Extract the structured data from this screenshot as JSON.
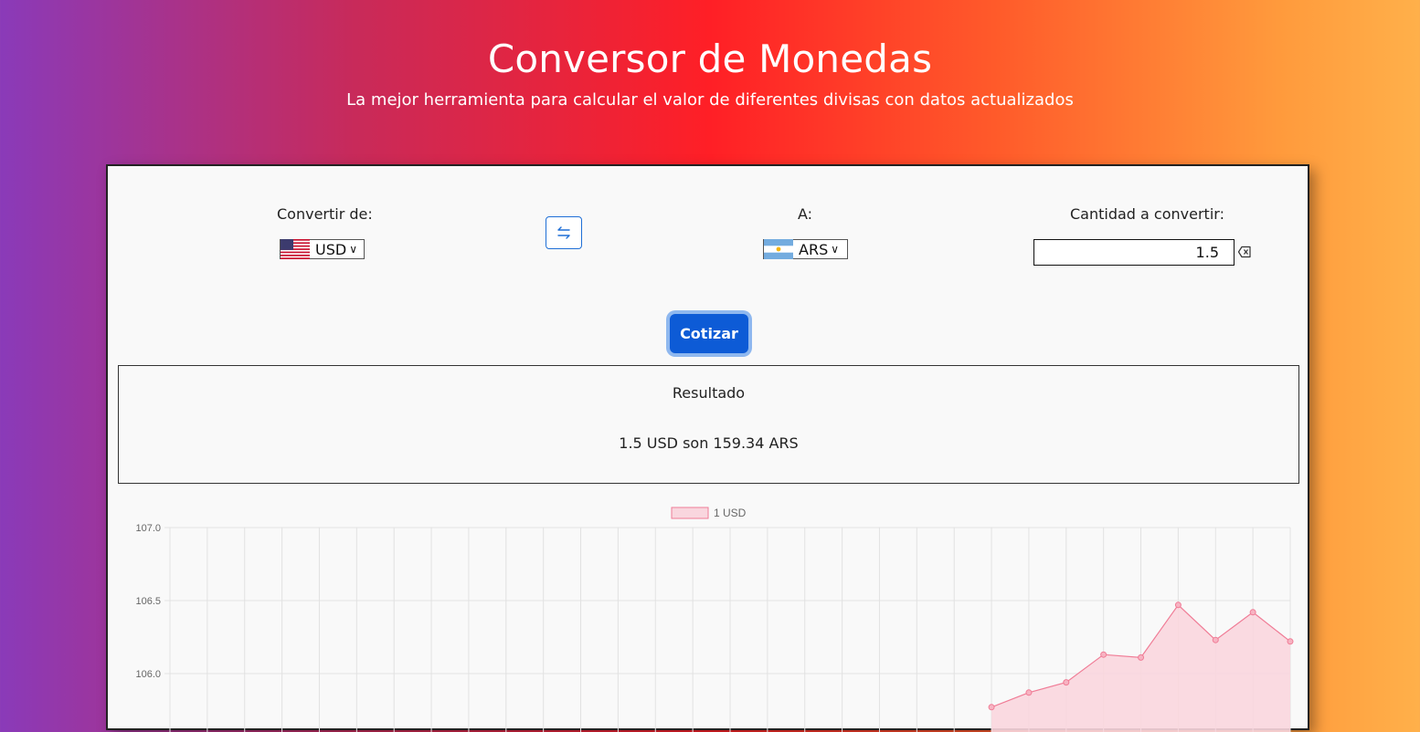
{
  "header": {
    "title": "Conversor de Monedas",
    "subtitle": "La mejor herramienta para calcular el valor de diferentes divisas con datos actualizados"
  },
  "form": {
    "from_label": "Convertir de:",
    "from_currency": "USD",
    "from_flag": "us-flag-icon",
    "swap_icon": "swap-arrows-icon",
    "to_label": "A:",
    "to_currency": "ARS",
    "to_flag": "ar-flag-icon",
    "amount_label": "Cantidad a convertir:",
    "amount_value": "1.5",
    "clear_icon": "backspace-icon",
    "submit_label": "Cotizar"
  },
  "result": {
    "title": "Resultado",
    "text": "1.5 USD son 159.34 ARS"
  },
  "colors": {
    "accent": "#0d5bd6",
    "series_line": "#f07c96",
    "series_fill": "#f9d6de"
  },
  "chart_data": {
    "type": "area",
    "legend": "1 USD",
    "y_ticks": [
      "107.0",
      "106.5",
      "106.0"
    ],
    "ylim": [
      105.8,
      107.0
    ],
    "n_points": 31,
    "series": [
      {
        "name": "1 USD",
        "values": [
          null,
          null,
          null,
          null,
          null,
          null,
          null,
          null,
          null,
          null,
          null,
          null,
          null,
          null,
          null,
          null,
          null,
          null,
          null,
          null,
          null,
          null,
          105.77,
          105.87,
          105.94,
          106.13,
          106.11,
          106.47,
          106.23,
          106.42,
          106.22
        ]
      }
    ]
  }
}
